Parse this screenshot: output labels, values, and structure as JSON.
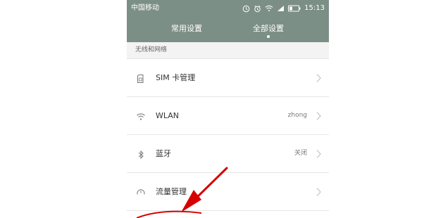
{
  "status_bar": {
    "carrier": "中国移动",
    "time": "15:13",
    "icons": [
      "clock-icon",
      "alarm-icon",
      "wifi-icon",
      "signal-icon",
      "battery-icon"
    ]
  },
  "tabs": [
    {
      "label": "常用设置"
    },
    {
      "label": "全部设置",
      "selected": true
    }
  ],
  "section": {
    "title": "无线和网络"
  },
  "settings": [
    {
      "icon": "sim-card-icon",
      "label": "SIM 卡管理",
      "value": ""
    },
    {
      "icon": "wifi-icon",
      "label": "WLAN",
      "value": "zhong"
    },
    {
      "icon": "bluetooth-icon",
      "label": "蓝牙",
      "value": "关闭"
    },
    {
      "icon": "data-usage-icon",
      "label": "流量管理",
      "value": ""
    }
  ],
  "colors": {
    "header": "#7c8f86",
    "background": "#f4f4f4",
    "annotation": "#d70000"
  }
}
